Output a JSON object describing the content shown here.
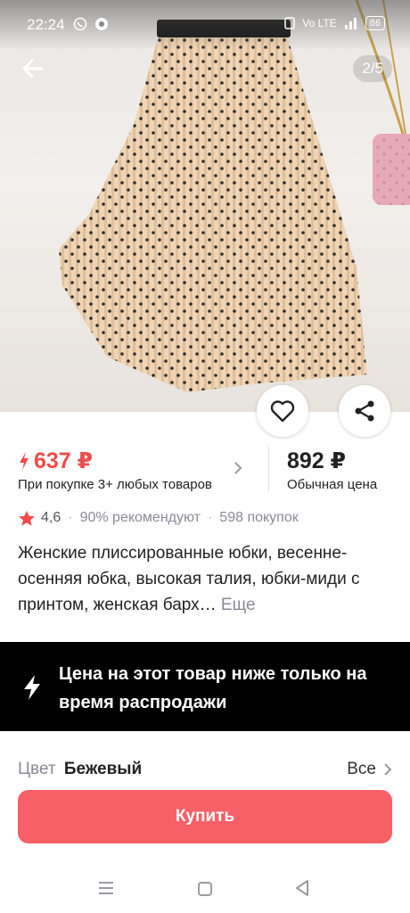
{
  "status_bar": {
    "time": "22:24",
    "battery": "86",
    "network": "Vo LTE"
  },
  "gallery": {
    "counter": "2/5",
    "image_subject": "beige pleated midi skirt with black polka dots"
  },
  "price": {
    "sale_price": "637 ₽",
    "sale_note": "При покупке 3+ любых товаров",
    "regular_price": "892 ₽",
    "regular_note": "Обычная цена",
    "accent_color": "#f04a4a"
  },
  "rating": {
    "value": "4,6",
    "recommend": "90% рекомендуют",
    "purchases": "598 покупок"
  },
  "product": {
    "title": "Женские плиссированные юбки, весенне-осенняя юбка, высокая талия, юбки-миди с принтом, женская барх…",
    "more": "Еще"
  },
  "promo": {
    "text": "Цена на этот товар ниже только на время распродажи"
  },
  "options": {
    "color_label": "Цвет",
    "color_value": "Бежевый",
    "all_label": "Все"
  },
  "actions": {
    "buy_label": "Купить",
    "buy_color": "#f86067"
  },
  "icons": [
    "back-arrow-icon",
    "heart-icon",
    "share-icon",
    "lightning-icon",
    "star-icon",
    "chevron-right-icon",
    "menu-icon",
    "home-square-icon",
    "back-triangle-icon"
  ]
}
